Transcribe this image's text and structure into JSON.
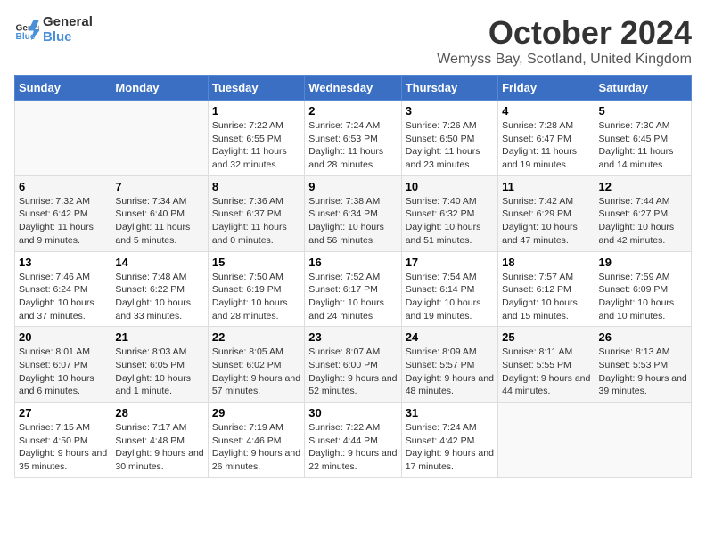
{
  "header": {
    "logo_line1": "General",
    "logo_line2": "Blue",
    "month": "October 2024",
    "location": "Wemyss Bay, Scotland, United Kingdom"
  },
  "weekdays": [
    "Sunday",
    "Monday",
    "Tuesday",
    "Wednesday",
    "Thursday",
    "Friday",
    "Saturday"
  ],
  "weeks": [
    [
      {
        "day": "",
        "sunrise": "",
        "sunset": "",
        "daylight": ""
      },
      {
        "day": "",
        "sunrise": "",
        "sunset": "",
        "daylight": ""
      },
      {
        "day": "1",
        "sunrise": "Sunrise: 7:22 AM",
        "sunset": "Sunset: 6:55 PM",
        "daylight": "Daylight: 11 hours and 32 minutes."
      },
      {
        "day": "2",
        "sunrise": "Sunrise: 7:24 AM",
        "sunset": "Sunset: 6:53 PM",
        "daylight": "Daylight: 11 hours and 28 minutes."
      },
      {
        "day": "3",
        "sunrise": "Sunrise: 7:26 AM",
        "sunset": "Sunset: 6:50 PM",
        "daylight": "Daylight: 11 hours and 23 minutes."
      },
      {
        "day": "4",
        "sunrise": "Sunrise: 7:28 AM",
        "sunset": "Sunset: 6:47 PM",
        "daylight": "Daylight: 11 hours and 19 minutes."
      },
      {
        "day": "5",
        "sunrise": "Sunrise: 7:30 AM",
        "sunset": "Sunset: 6:45 PM",
        "daylight": "Daylight: 11 hours and 14 minutes."
      }
    ],
    [
      {
        "day": "6",
        "sunrise": "Sunrise: 7:32 AM",
        "sunset": "Sunset: 6:42 PM",
        "daylight": "Daylight: 11 hours and 9 minutes."
      },
      {
        "day": "7",
        "sunrise": "Sunrise: 7:34 AM",
        "sunset": "Sunset: 6:40 PM",
        "daylight": "Daylight: 11 hours and 5 minutes."
      },
      {
        "day": "8",
        "sunrise": "Sunrise: 7:36 AM",
        "sunset": "Sunset: 6:37 PM",
        "daylight": "Daylight: 11 hours and 0 minutes."
      },
      {
        "day": "9",
        "sunrise": "Sunrise: 7:38 AM",
        "sunset": "Sunset: 6:34 PM",
        "daylight": "Daylight: 10 hours and 56 minutes."
      },
      {
        "day": "10",
        "sunrise": "Sunrise: 7:40 AM",
        "sunset": "Sunset: 6:32 PM",
        "daylight": "Daylight: 10 hours and 51 minutes."
      },
      {
        "day": "11",
        "sunrise": "Sunrise: 7:42 AM",
        "sunset": "Sunset: 6:29 PM",
        "daylight": "Daylight: 10 hours and 47 minutes."
      },
      {
        "day": "12",
        "sunrise": "Sunrise: 7:44 AM",
        "sunset": "Sunset: 6:27 PM",
        "daylight": "Daylight: 10 hours and 42 minutes."
      }
    ],
    [
      {
        "day": "13",
        "sunrise": "Sunrise: 7:46 AM",
        "sunset": "Sunset: 6:24 PM",
        "daylight": "Daylight: 10 hours and 37 minutes."
      },
      {
        "day": "14",
        "sunrise": "Sunrise: 7:48 AM",
        "sunset": "Sunset: 6:22 PM",
        "daylight": "Daylight: 10 hours and 33 minutes."
      },
      {
        "day": "15",
        "sunrise": "Sunrise: 7:50 AM",
        "sunset": "Sunset: 6:19 PM",
        "daylight": "Daylight: 10 hours and 28 minutes."
      },
      {
        "day": "16",
        "sunrise": "Sunrise: 7:52 AM",
        "sunset": "Sunset: 6:17 PM",
        "daylight": "Daylight: 10 hours and 24 minutes."
      },
      {
        "day": "17",
        "sunrise": "Sunrise: 7:54 AM",
        "sunset": "Sunset: 6:14 PM",
        "daylight": "Daylight: 10 hours and 19 minutes."
      },
      {
        "day": "18",
        "sunrise": "Sunrise: 7:57 AM",
        "sunset": "Sunset: 6:12 PM",
        "daylight": "Daylight: 10 hours and 15 minutes."
      },
      {
        "day": "19",
        "sunrise": "Sunrise: 7:59 AM",
        "sunset": "Sunset: 6:09 PM",
        "daylight": "Daylight: 10 hours and 10 minutes."
      }
    ],
    [
      {
        "day": "20",
        "sunrise": "Sunrise: 8:01 AM",
        "sunset": "Sunset: 6:07 PM",
        "daylight": "Daylight: 10 hours and 6 minutes."
      },
      {
        "day": "21",
        "sunrise": "Sunrise: 8:03 AM",
        "sunset": "Sunset: 6:05 PM",
        "daylight": "Daylight: 10 hours and 1 minute."
      },
      {
        "day": "22",
        "sunrise": "Sunrise: 8:05 AM",
        "sunset": "Sunset: 6:02 PM",
        "daylight": "Daylight: 9 hours and 57 minutes."
      },
      {
        "day": "23",
        "sunrise": "Sunrise: 8:07 AM",
        "sunset": "Sunset: 6:00 PM",
        "daylight": "Daylight: 9 hours and 52 minutes."
      },
      {
        "day": "24",
        "sunrise": "Sunrise: 8:09 AM",
        "sunset": "Sunset: 5:57 PM",
        "daylight": "Daylight: 9 hours and 48 minutes."
      },
      {
        "day": "25",
        "sunrise": "Sunrise: 8:11 AM",
        "sunset": "Sunset: 5:55 PM",
        "daylight": "Daylight: 9 hours and 44 minutes."
      },
      {
        "day": "26",
        "sunrise": "Sunrise: 8:13 AM",
        "sunset": "Sunset: 5:53 PM",
        "daylight": "Daylight: 9 hours and 39 minutes."
      }
    ],
    [
      {
        "day": "27",
        "sunrise": "Sunrise: 7:15 AM",
        "sunset": "Sunset: 4:50 PM",
        "daylight": "Daylight: 9 hours and 35 minutes."
      },
      {
        "day": "28",
        "sunrise": "Sunrise: 7:17 AM",
        "sunset": "Sunset: 4:48 PM",
        "daylight": "Daylight: 9 hours and 30 minutes."
      },
      {
        "day": "29",
        "sunrise": "Sunrise: 7:19 AM",
        "sunset": "Sunset: 4:46 PM",
        "daylight": "Daylight: 9 hours and 26 minutes."
      },
      {
        "day": "30",
        "sunrise": "Sunrise: 7:22 AM",
        "sunset": "Sunset: 4:44 PM",
        "daylight": "Daylight: 9 hours and 22 minutes."
      },
      {
        "day": "31",
        "sunrise": "Sunrise: 7:24 AM",
        "sunset": "Sunset: 4:42 PM",
        "daylight": "Daylight: 9 hours and 17 minutes."
      },
      {
        "day": "",
        "sunrise": "",
        "sunset": "",
        "daylight": ""
      },
      {
        "day": "",
        "sunrise": "",
        "sunset": "",
        "daylight": ""
      }
    ]
  ]
}
